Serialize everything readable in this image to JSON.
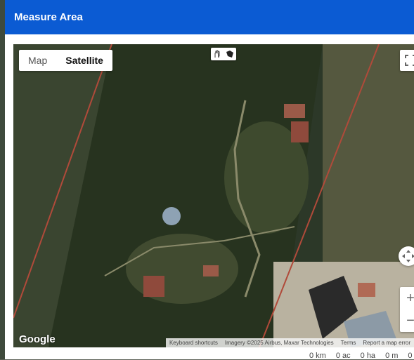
{
  "modal": {
    "title": "Measure Area"
  },
  "map": {
    "type_controls": {
      "map_label": "Map",
      "satellite_label": "Satellite",
      "selected": "Satellite"
    },
    "draw_tools": [
      "hand-icon",
      "polygon-draw-icon"
    ],
    "controls": {
      "zoom_in": "+",
      "zoom_out": "−"
    },
    "logo": "Google",
    "attribution": {
      "shortcuts": "Keyboard shortcuts",
      "imagery": "Imagery ©2025 Airbus, Maxar Technologies",
      "terms": "Terms",
      "report": "Report a map error"
    }
  },
  "measurements": {
    "km": "0 km",
    "ac": "0 ac",
    "ha": "0 ha",
    "m": "0 m",
    "other": "0"
  }
}
